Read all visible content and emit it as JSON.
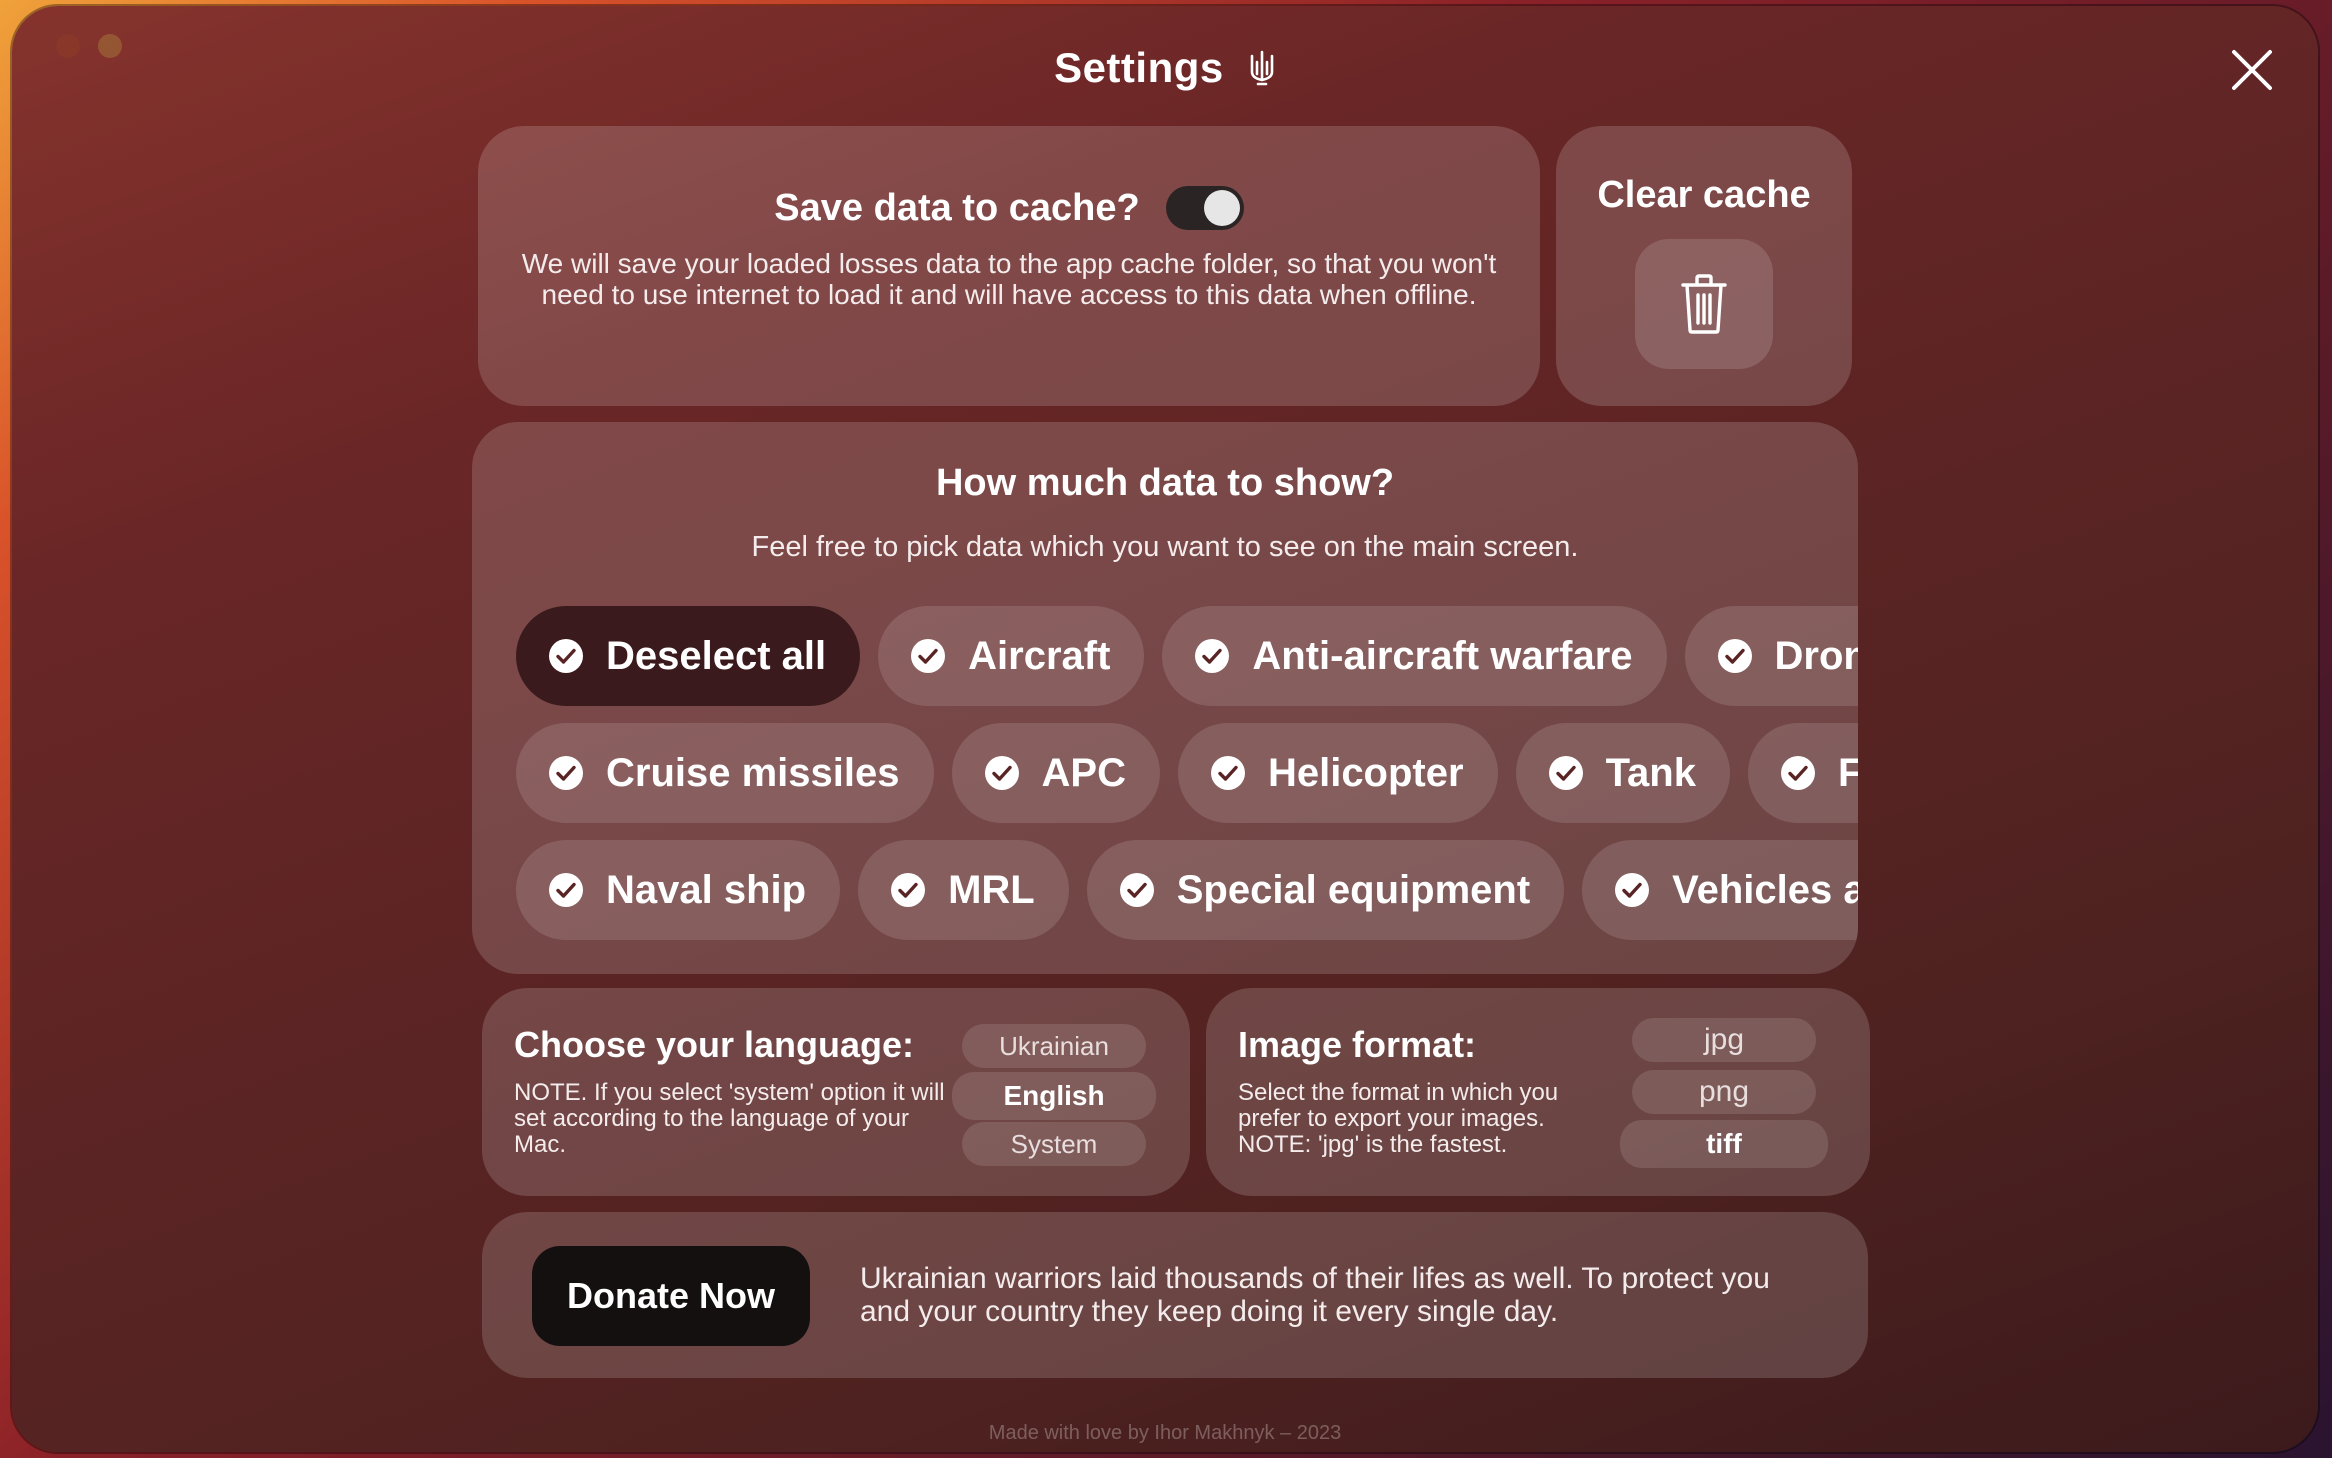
{
  "window": {
    "title": "Settings"
  },
  "cache": {
    "title": "Save data to cache?",
    "enabled": true,
    "description": "We will save your loaded losses data to the app cache folder, so that you won't need to use internet to load it and will have access to this data when offline."
  },
  "clear_cache": {
    "title": "Clear cache"
  },
  "data_filter": {
    "title": "How much data to show?",
    "subtitle": "Feel free to pick data which you want to see on the main screen.",
    "rows": [
      [
        {
          "label": "Deselect all",
          "checked": true
        },
        {
          "label": "Aircraft",
          "checked": true
        },
        {
          "label": "Anti-aircraft warfare",
          "checked": true
        },
        {
          "label": "Drone",
          "checked": true
        }
      ],
      [
        {
          "label": "Cruise missiles",
          "checked": true
        },
        {
          "label": "APC",
          "checked": true
        },
        {
          "label": "Helicopter",
          "checked": true
        },
        {
          "label": "Tank",
          "checked": true
        },
        {
          "label": "Field artillery",
          "checked": true
        }
      ],
      [
        {
          "label": "Naval ship",
          "checked": true
        },
        {
          "label": "MRL",
          "checked": true
        },
        {
          "label": "Special equipment",
          "checked": true
        },
        {
          "label": "Vehicles and fuel tanks",
          "checked": true
        }
      ]
    ]
  },
  "language": {
    "title": "Choose your language:",
    "note": "NOTE. If you select 'system' option it will set according to the language of your Mac.",
    "options": [
      "Ukrainian",
      "English",
      "System"
    ],
    "selected": "English"
  },
  "image_format": {
    "title": "Image format:",
    "note": "Select the format in which you prefer to export your images. NOTE: 'jpg' is the fastest.",
    "options": [
      "jpg",
      "png",
      "tiff"
    ],
    "selected": "tiff"
  },
  "donate": {
    "button_label": "Donate Now",
    "text": "Ukrainian warriors laid thousands of their lifes as well. To protect you and your country they keep doing it every single day."
  },
  "footer": {
    "text": "Made with love by Ihor Makhnyk – 2023"
  }
}
